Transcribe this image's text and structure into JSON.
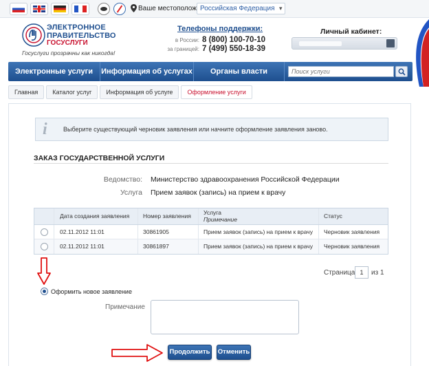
{
  "topbar": {
    "languages": [
      "ru",
      "en",
      "de",
      "fr"
    ],
    "location_label": "Ваше местоположение:",
    "location_value": "Российская Федерация"
  },
  "header": {
    "logo_line1": "ЭЛЕКТРОННОЕ",
    "logo_line2": "ПРАВИТЕЛЬСТВО",
    "logo_line3": "ГОСУСЛУГИ",
    "slogan": "Госуслуги прозрачны как никогда!",
    "support_title": "Телефоны поддержки:",
    "support": [
      {
        "label": "в России:",
        "number": "8 (800) 100-70-10"
      },
      {
        "label": "за границей:",
        "number": "7 (499) 550-18-39"
      }
    ],
    "cabinet_title": "Личный кабинет:"
  },
  "nav": {
    "items": [
      "Электронные услуги",
      "Информация об услугах",
      "Органы власти"
    ],
    "search_placeholder": "Поиск услуги"
  },
  "breadcrumb": [
    "Главная",
    "Каталог услуг",
    "Информация об услуге",
    "Оформление услуги"
  ],
  "info": {
    "text": "Выберите существующий черновик заявления или начните оформление заявления заново."
  },
  "order": {
    "title": "ЗАКАЗ ГОСУДАРСТВЕННОЙ УСЛУГИ",
    "fields": [
      {
        "label": "Ведомство:",
        "value": "Министерство здравоохранения Российской Федерации"
      },
      {
        "label": "Услуга",
        "value": "Прием заявок (запись) на прием к врачу"
      }
    ]
  },
  "table": {
    "headers": {
      "date": "Дата создания заявления",
      "number": "Номер заявления",
      "service": "Услуга",
      "note": "Примечание",
      "status": "Статус"
    },
    "rows": [
      {
        "date": "02.11.2012 11:01",
        "number": "30861905",
        "service": "Прием заявок (запись) на прием к врачу",
        "status": "Черновик заявления"
      },
      {
        "date": "02.11.2012 11:01",
        "number": "30861897",
        "service": "Прием заявок (запись) на прием к врачу",
        "status": "Черновик заявления"
      }
    ]
  },
  "pager": {
    "label": "Страница",
    "current": "1",
    "of": "из 1"
  },
  "new_application_label": "Оформить новое заявление",
  "note_label": "Примечание",
  "buttons": {
    "continue": "Продолжить",
    "cancel": "Отменить"
  },
  "colors": {
    "accent": "#1f4f8f",
    "brand_red": "#c8102e",
    "arrow": "#e01010"
  }
}
